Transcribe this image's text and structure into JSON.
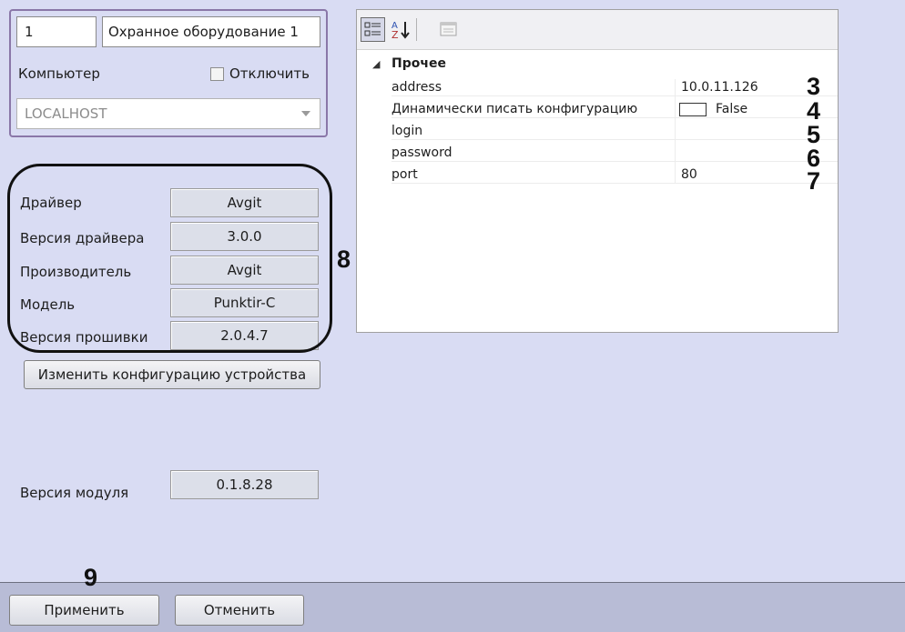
{
  "object": {
    "id": "1",
    "name": "Охранное оборудование 1"
  },
  "computer": {
    "label": "Компьютер",
    "disable_label": "Отключить",
    "value": "LOCALHOST"
  },
  "info": [
    {
      "label": "Драйвер",
      "value": "Avgit"
    },
    {
      "label": "Версия драйвера",
      "value": "3.0.0"
    },
    {
      "label": "Производитель",
      "value": "Avgit"
    },
    {
      "label": "Модель",
      "value": "Punktir-C"
    },
    {
      "label": "Версия прошивки",
      "value": "2.0.4.7"
    }
  ],
  "change_config_button": "Изменить конфигурацию устройства",
  "module": {
    "label": "Версия модуля",
    "value": "0.1.8.28"
  },
  "grid": {
    "category": "Прочее",
    "rows": [
      {
        "key": "address",
        "value": "10.0.11.126"
      },
      {
        "key": "Динамически писать конфигурацию",
        "value": "False"
      },
      {
        "key": "login",
        "value": ""
      },
      {
        "key": "password",
        "value": ""
      },
      {
        "key": "port",
        "value": "80"
      }
    ]
  },
  "annotations": {
    "n3": "3",
    "n4": "4",
    "n5": "5",
    "n6": "6",
    "n7": "7",
    "n8": "8",
    "n9": "9"
  },
  "buttons": {
    "apply": "Применить",
    "cancel": "Отменить"
  }
}
